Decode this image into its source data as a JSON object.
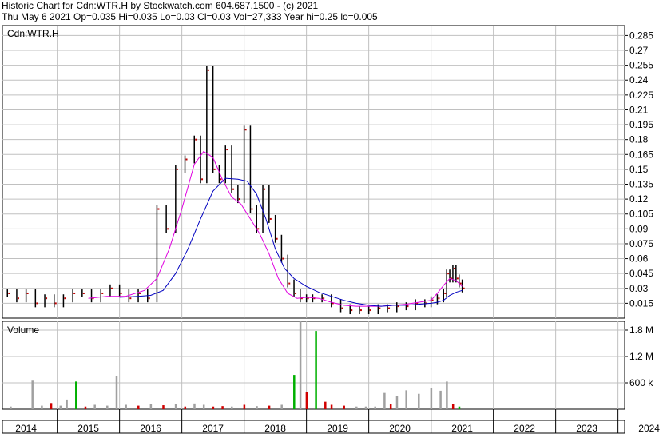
{
  "header": {
    "line1": "Historic Chart for Cdn:WTR.H by Stockwatch.com 604.687.1500 - (c) 2021",
    "line2": "Thu May  6 2021  Op=0.035  Hi=0.035  Lo=0.03  Cl=0.03  Vol=27,333  Year hi=0.25  lo=0.005"
  },
  "chart_data": [
    {
      "type": "line",
      "title": "Cdn:WTR.H",
      "ylim": [
        0,
        0.295
      ],
      "y_ticks": [
        "0.285",
        "0.27",
        "0.255",
        "0.24",
        "0.225",
        "0.21",
        "0.195",
        "0.18",
        "0.165",
        "0.15",
        "0.135",
        "0.12",
        "0.105",
        "0.09",
        "0.075",
        "0.06",
        "0.045",
        "0.03",
        "0.015"
      ],
      "x_ticks": [
        "2014",
        "2015",
        "2016",
        "2017",
        "2018",
        "2019",
        "2020",
        "2021",
        "2022",
        "2023",
        "2024"
      ],
      "grid": true,
      "colors": {
        "price": "#000000",
        "close_tick": "#c00000",
        "ma_short": "#e000e0",
        "ma_long": "#0000c0"
      },
      "series": [
        {
          "role": "price",
          "x": [
            2013.7,
            2013.85,
            2014.0,
            2014.15,
            2014.3,
            2014.45,
            2014.6,
            2014.75,
            2014.9,
            2015.05,
            2015.2,
            2015.35,
            2015.5,
            2015.65,
            2015.8,
            2015.95,
            2016.1,
            2016.25,
            2016.4,
            2016.55,
            2016.7,
            2016.8,
            2016.9,
            2017.0,
            2017.1,
            2017.2,
            2017.3,
            2017.4,
            2017.5,
            2017.6,
            2017.7,
            2017.8,
            2017.9,
            2018.0,
            2018.1,
            2018.2,
            2018.3,
            2018.4,
            2018.5,
            2018.6,
            2018.75,
            2018.9,
            2019.05,
            2019.2,
            2019.35,
            2019.5,
            2019.65,
            2019.8,
            2019.95,
            2020.1,
            2020.25,
            2020.4,
            2020.5,
            2020.6,
            2020.7,
            2020.75,
            2020.8,
            2020.85,
            2020.9,
            2020.95,
            2021.0
          ],
          "values": [
            0.025,
            0.02,
            0.025,
            0.015,
            0.02,
            0.015,
            0.02,
            0.025,
            0.025,
            0.02,
            0.025,
            0.03,
            0.025,
            0.02,
            0.025,
            0.02,
            0.11,
            0.09,
            0.15,
            0.16,
            0.18,
            0.14,
            0.25,
            0.15,
            0.14,
            0.17,
            0.13,
            0.12,
            0.19,
            0.11,
            0.09,
            0.13,
            0.1,
            0.08,
            0.06,
            0.035,
            0.025,
            0.02,
            0.02,
            0.02,
            0.02,
            0.015,
            0.01,
            0.008,
            0.008,
            0.008,
            0.01,
            0.01,
            0.012,
            0.012,
            0.015,
            0.015,
            0.018,
            0.02,
            0.025,
            0.045,
            0.04,
            0.05,
            0.04,
            0.035,
            0.03
          ]
        },
        {
          "role": "ma_short",
          "x": [
            2015.0,
            2015.3,
            2015.6,
            2015.9,
            2016.1,
            2016.3,
            2016.5,
            2016.7,
            2016.85,
            2017.0,
            2017.15,
            2017.3,
            2017.45,
            2017.6,
            2017.75,
            2017.9,
            2018.05,
            2018.2,
            2018.35,
            2018.5,
            2018.7,
            2018.9,
            2019.1,
            2019.3,
            2019.5,
            2019.7,
            2019.9,
            2020.1,
            2020.3,
            2020.5,
            2020.6,
            2020.7,
            2020.8,
            2020.9,
            2021.0
          ],
          "values": [
            0.02,
            0.022,
            0.022,
            0.028,
            0.04,
            0.07,
            0.11,
            0.155,
            0.168,
            0.162,
            0.14,
            0.122,
            0.115,
            0.1,
            0.085,
            0.065,
            0.04,
            0.025,
            0.02,
            0.021,
            0.02,
            0.016,
            0.013,
            0.012,
            0.012,
            0.012,
            0.013,
            0.014,
            0.016,
            0.018,
            0.025,
            0.033,
            0.04,
            0.038,
            0.032
          ]
        },
        {
          "role": "ma_long",
          "x": [
            2015.5,
            2015.8,
            2016.0,
            2016.2,
            2016.4,
            2016.6,
            2016.8,
            2017.0,
            2017.2,
            2017.4,
            2017.55,
            2017.7,
            2017.85,
            2018.0,
            2018.15,
            2018.3,
            2018.5,
            2018.7,
            2018.9,
            2019.1,
            2019.3,
            2019.5,
            2019.7,
            2019.9,
            2020.1,
            2020.3,
            2020.5,
            2020.6,
            2020.7,
            2020.8,
            2020.9,
            2021.0
          ],
          "values": [
            0.021,
            0.022,
            0.023,
            0.028,
            0.045,
            0.07,
            0.1,
            0.128,
            0.141,
            0.14,
            0.138,
            0.125,
            0.1,
            0.07,
            0.05,
            0.04,
            0.032,
            0.026,
            0.022,
            0.018,
            0.015,
            0.013,
            0.012,
            0.013,
            0.013,
            0.014,
            0.015,
            0.016,
            0.018,
            0.023,
            0.026,
            0.028
          ]
        }
      ]
    },
    {
      "type": "bar",
      "title": "Volume",
      "ylim": [
        0,
        2000000
      ],
      "y_ticks": [
        "1.8 M",
        "1.2 M",
        "600 k"
      ],
      "y_tick_values": [
        1800000,
        1200000,
        600000
      ],
      "colors": {
        "up": "#00b000",
        "down": "#d00000",
        "flat": "#a0a0a0"
      },
      "x": [
        2013.75,
        2014.1,
        2014.25,
        2014.4,
        2014.55,
        2014.65,
        2014.8,
        2014.95,
        2015.1,
        2015.3,
        2015.45,
        2015.6,
        2015.8,
        2016.0,
        2016.2,
        2016.4,
        2016.55,
        2016.7,
        2016.85,
        2017.0,
        2017.15,
        2017.3,
        2017.5,
        2017.7,
        2017.9,
        2018.1,
        2018.3,
        2018.4,
        2018.5,
        2018.65,
        2018.8,
        2018.9,
        2019.1,
        2019.3,
        2019.45,
        2019.6,
        2019.75,
        2019.85,
        2019.95,
        2020.1,
        2020.3,
        2020.5,
        2020.65,
        2020.75,
        2020.85,
        2020.95
      ],
      "values": [
        60000,
        650000,
        80000,
        140000,
        80000,
        220000,
        630000,
        60000,
        100000,
        80000,
        760000,
        100000,
        80000,
        120000,
        90000,
        120000,
        60000,
        130000,
        100000,
        60000,
        70000,
        60000,
        100000,
        70000,
        80000,
        100000,
        780000,
        2000000,
        400000,
        1780000,
        170000,
        100000,
        80000,
        60000,
        60000,
        60000,
        370000,
        120000,
        300000,
        430000,
        350000,
        480000,
        420000,
        630000,
        120000,
        60000
      ],
      "direction": [
        "flat",
        "flat",
        "flat",
        "down",
        "flat",
        "flat",
        "up",
        "down",
        "flat",
        "flat",
        "flat",
        "flat",
        "down",
        "flat",
        "down",
        "flat",
        "down",
        "flat",
        "flat",
        "down",
        "down",
        "flat",
        "down",
        "flat",
        "down",
        "flat",
        "up",
        "flat",
        "down",
        "up",
        "down",
        "down",
        "down",
        "flat",
        "flat",
        "flat",
        "flat",
        "down",
        "flat",
        "flat",
        "flat",
        "flat",
        "flat",
        "flat",
        "down",
        "up"
      ]
    }
  ]
}
